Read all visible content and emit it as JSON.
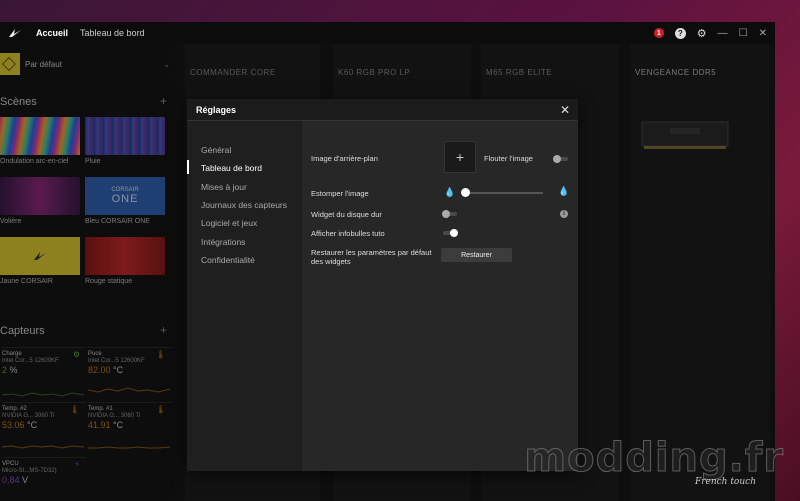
{
  "titlebar": {
    "tabs": [
      "Accueil",
      "Tableau de bord"
    ],
    "notification_count": "1",
    "help_glyph": "?",
    "settings_glyph": "⚙",
    "controls": [
      "—",
      "☐",
      "✕"
    ]
  },
  "left": {
    "profile_label": "Par défaut",
    "scenes_title": "Scènes",
    "scenes": [
      {
        "label": "Ondulation arc-en-ciel"
      },
      {
        "label": "Pluie"
      },
      {
        "label": "Volière"
      },
      {
        "label": "Bleu CORSAIR ONE",
        "thumb_text_top": "CORSAIR",
        "thumb_text_bottom": "ONE"
      },
      {
        "label": "Jaune CORSAIR"
      },
      {
        "label": "Rouge statique"
      }
    ],
    "sensors_title": "Capteurs",
    "sensors": [
      {
        "name": "Charge",
        "sub": "Intel Cor...5 12600KF",
        "value": "2",
        "unit": "%",
        "value_color": "#5fa83a",
        "icon": "gear-icon"
      },
      {
        "name": "Puce",
        "sub": "Intel Cor...5 12600KF",
        "value": "82.00",
        "unit": "°C",
        "value_color": "#c07a1a",
        "icon": "thermometer-icon"
      },
      {
        "name": "Temp. #2",
        "sub": "NVIDIA G... 3060 Ti",
        "value": "53.06",
        "unit": "°C",
        "value_color": "#c07a1a",
        "icon": "thermometer-icon"
      },
      {
        "name": "Temp. #1",
        "sub": "NVIDIA G... 3060 Ti",
        "value": "41.91",
        "unit": "°C",
        "value_color": "#c07a1a",
        "icon": "thermometer-icon"
      },
      {
        "name": "VPCU",
        "sub": "Micro-St...MS-7D32)",
        "value": "0.84",
        "unit": "V",
        "value_color": "#8a4fc0",
        "icon": "lightning-icon"
      }
    ]
  },
  "devices": [
    "COMMANDER CORE",
    "K60 RGB PRO LP",
    "M65 RGB ELITE",
    "VENGEANCE DDR5"
  ],
  "modal": {
    "title": "Réglages",
    "close_glyph": "✕",
    "nav": [
      "Général",
      "Tableau de bord",
      "Mises à jour",
      "Journaux des capteurs",
      "Logiciel et jeux",
      "Intégrations",
      "Confidentialité"
    ],
    "active_nav": 1,
    "settings": {
      "background_label": "Image d'arrière-plan",
      "add_glyph": "+",
      "blur_label": "Flouter l'image",
      "blur_on": false,
      "fade_label": "Estomper l'image",
      "fade_value": 0.0,
      "disk_widget_label": "Widget du disque dur",
      "disk_widget_on": false,
      "info_glyph": "i",
      "tooltips_label": "Afficher infobulles tuto",
      "tooltips_on": true,
      "restore_label_line1": "Restaurer les paramètres par défaut",
      "restore_label_line2": "des widgets",
      "restore_button": "Restaurer"
    }
  },
  "watermark": {
    "main": "modding.fr",
    "sub": "French touch"
  }
}
